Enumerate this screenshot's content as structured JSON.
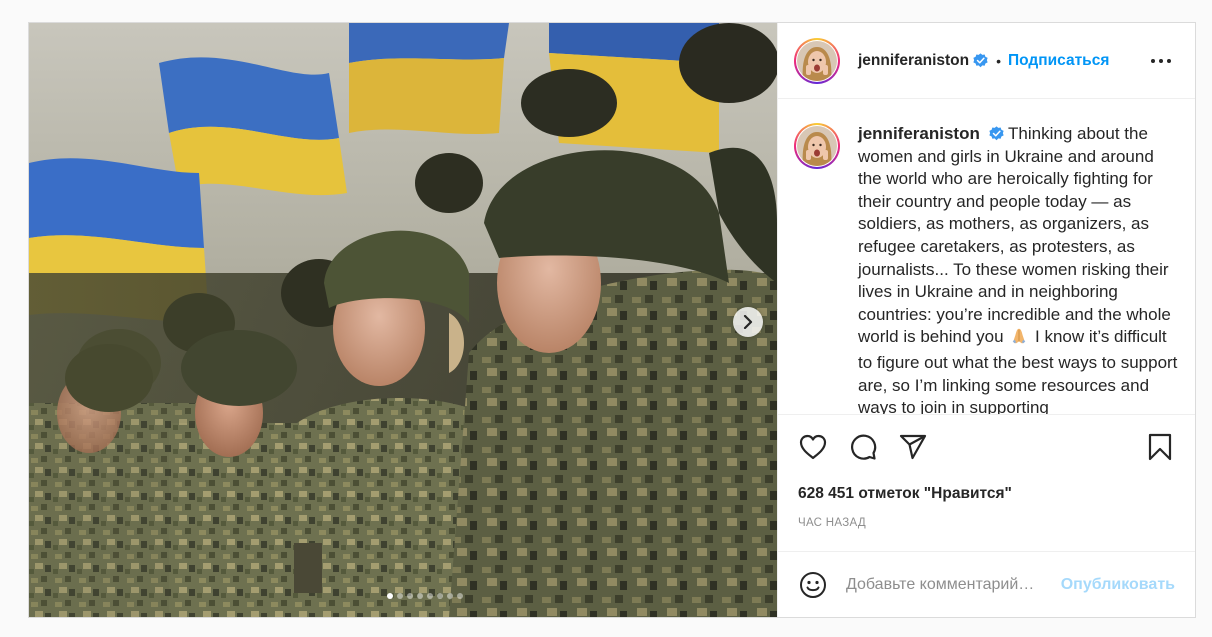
{
  "post": {
    "image_alt": "Women soldiers in Ukrainian army uniforms standing in a row with Ukrainian flags in the background",
    "carousel": {
      "total": 8,
      "active_index": 0
    },
    "next_icon": "chevron-right-icon"
  },
  "author": {
    "username": "jenniferaniston",
    "verified": true,
    "verified_icon": "verified-badge-icon",
    "separator": "•",
    "follow_label": "Подписаться",
    "more_icon": "more-options-icon"
  },
  "caption": {
    "username": "jenniferaniston",
    "text_before_emoji": "Thinking about the women and girls in Ukraine and around the world who are heroically fighting for their country and people today — as soldiers, as mothers, as organizers, as refugee caretakers, as protesters, as journalists... To these women risking their lives in Ukraine and in neighboring countries: you’re incredible and the whole world is behind you",
    "emoji": "folded-hands-emoji",
    "text_after_emoji": "I know it’s difficult to figure out what the best ways to support are, so I’m linking some resources and ways to join in supporting"
  },
  "actions": {
    "like_icon": "heart-icon",
    "comment_icon": "comment-icon",
    "share_icon": "share-icon",
    "save_icon": "bookmark-icon"
  },
  "likes_text": "628 451 отметок \"Нравится\"",
  "timestamp": "ЧАС НАЗАД",
  "comment": {
    "emoji_icon": "smiley-icon",
    "placeholder": "Добавьте комментарий…",
    "value": "",
    "publish_label": "Опубликовать"
  },
  "colors": {
    "accent": "#0095f6",
    "text": "#262626",
    "muted": "#8e8e8e",
    "border": "#dbdbdb"
  }
}
